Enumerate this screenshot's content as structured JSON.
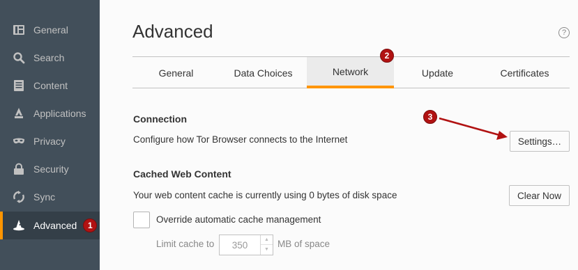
{
  "sidebar": {
    "items": [
      {
        "label": "General",
        "icon": "general-icon"
      },
      {
        "label": "Search",
        "icon": "search-icon"
      },
      {
        "label": "Content",
        "icon": "content-icon"
      },
      {
        "label": "Applications",
        "icon": "applications-icon"
      },
      {
        "label": "Privacy",
        "icon": "privacy-mask-icon"
      },
      {
        "label": "Security",
        "icon": "security-lock-icon"
      },
      {
        "label": "Sync",
        "icon": "sync-icon"
      },
      {
        "label": "Advanced",
        "icon": "advanced-wizard-hat-icon",
        "active": true
      }
    ]
  },
  "page": {
    "title": "Advanced",
    "help": "?"
  },
  "tabs": {
    "items": [
      "General",
      "Data Choices",
      "Network",
      "Update",
      "Certificates"
    ],
    "selected": "Network"
  },
  "connection": {
    "heading": "Connection",
    "description": "Configure how Tor Browser connects to the Internet",
    "settings_button": "Settings…"
  },
  "cache": {
    "heading": "Cached Web Content",
    "description": "Your web content cache is currently using 0 bytes of disk space",
    "clear_button": "Clear Now",
    "override_label": "Override automatic cache management",
    "override_checked": false,
    "limit_label": "Limit cache to",
    "limit_value": "350",
    "limit_unit": "MB of space"
  },
  "annotations": {
    "step1": "1",
    "step2": "2",
    "step3": "3"
  },
  "colors": {
    "sidebar_bg": "#424f5a",
    "accent": "#ff9500",
    "badge": "#b11212",
    "arrow": "#b11212"
  }
}
